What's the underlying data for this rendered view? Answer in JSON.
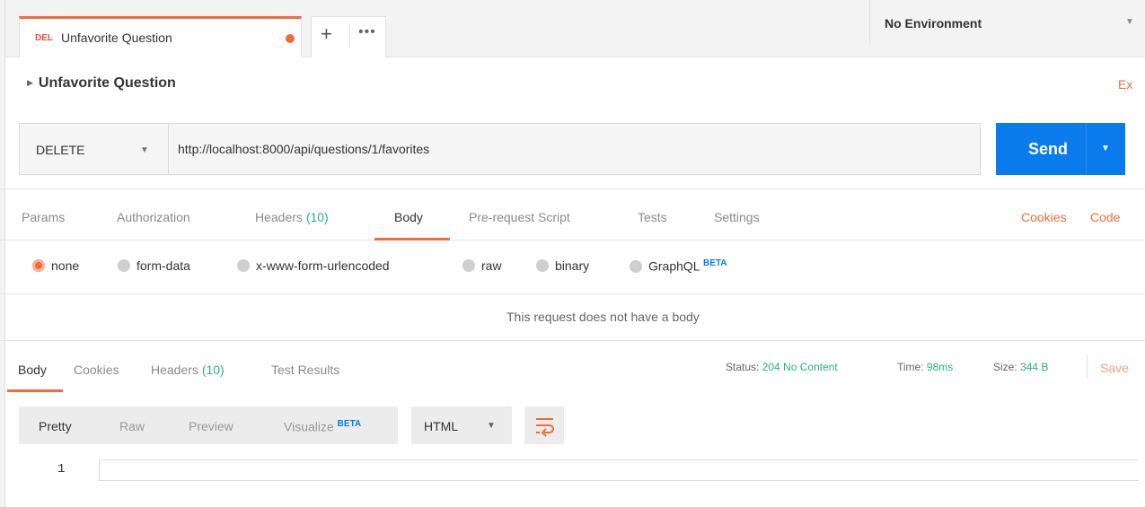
{
  "tab": {
    "method_badge": "DEL",
    "title": "Unfavorite Question",
    "plus_icon": "+",
    "more_icon": "•••"
  },
  "environment": {
    "label": "No Environment",
    "caret": "▼"
  },
  "breadcrumb": {
    "title": "Unfavorite Question",
    "expand_icon": "▶",
    "examples_label": "Ex"
  },
  "request": {
    "method": "DELETE",
    "url": "http://localhost:8000/api/questions/1/favorites",
    "send_label": "Send",
    "caret": "▼"
  },
  "request_tabs": {
    "params": "Params",
    "authorization": "Authorization",
    "headers": "Headers",
    "headers_count": "(10)",
    "body": "Body",
    "prerequest": "Pre-request Script",
    "tests": "Tests",
    "settings": "Settings",
    "cookies": "Cookies",
    "code": "Code"
  },
  "body_types": {
    "none": "none",
    "form_data": "form-data",
    "urlencoded": "x-www-form-urlencoded",
    "raw": "raw",
    "binary": "binary",
    "graphql": "GraphQL",
    "graphql_badge": "BETA",
    "selected": "none"
  },
  "no_body_message": "This request does not have a body",
  "response": {
    "tabs": {
      "body": "Body",
      "cookies": "Cookies",
      "headers": "Headers",
      "headers_count": "(10)",
      "test_results": "Test Results"
    },
    "status_label": "Status:",
    "status_value": "204 No Content",
    "time_label": "Time:",
    "time_value": "98ms",
    "size_label": "Size:",
    "size_value": "344 B",
    "save_label": "Save"
  },
  "format": {
    "pretty": "Pretty",
    "raw": "Raw",
    "preview": "Preview",
    "visualize": "Visualize",
    "visualize_badge": "BETA",
    "language": "HTML",
    "caret": "▼",
    "wrap_icon": "wrap-lines-icon"
  },
  "editor": {
    "line_number": "1"
  },
  "colors": {
    "accent": "#f26b3a",
    "send": "#097bed",
    "success": "#26b47f"
  }
}
